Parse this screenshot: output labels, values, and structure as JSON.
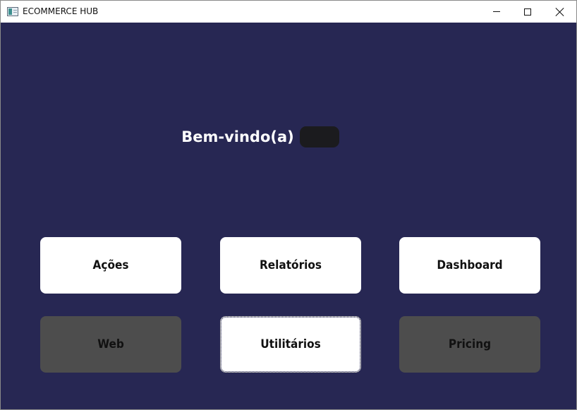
{
  "window": {
    "title": "ECOMMERCE HUB"
  },
  "welcome": {
    "text": "Bem-vindo(a)"
  },
  "colors": {
    "background": "#272753",
    "tile_active": "#ffffff",
    "tile_disabled": "#4d4d4d",
    "text": "#111111"
  },
  "tiles": [
    {
      "label": "Ações",
      "state": "active"
    },
    {
      "label": "Relatórios",
      "state": "active"
    },
    {
      "label": "Dashboard",
      "state": "active"
    },
    {
      "label": "Web",
      "state": "disabled"
    },
    {
      "label": "Utilitários",
      "state": "focused"
    },
    {
      "label": "Pricing",
      "state": "disabled"
    }
  ]
}
